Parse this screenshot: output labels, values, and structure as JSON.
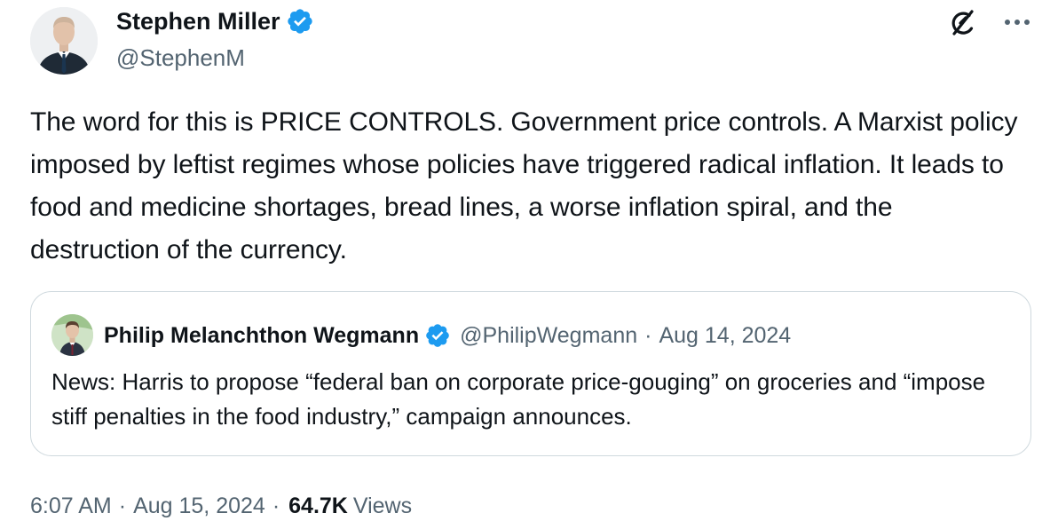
{
  "author": {
    "name": "Stephen Miller",
    "handle": "@StephenM",
    "verified": true
  },
  "tweet": {
    "text": "The word for this is PRICE CONTROLS. Government price controls. A Marxist policy imposed by leftist regimes whose policies have triggered radical inflation. It leads to food and medicine shortages, bread lines, a worse inflation spiral, and the destruction of the currency."
  },
  "quoted_tweet": {
    "author_name": "Philip Melanchthon Wegmann",
    "handle": "@PhilipWegmann",
    "separator": "·",
    "date": "Aug 14, 2024",
    "verified": true,
    "text": "News: Harris to propose “federal ban on corporate price-gouging” on groceries and “impose stiff penalties in the food industry,” campaign announces."
  },
  "meta": {
    "time": "6:07 AM",
    "separator": "·",
    "date": "Aug 15, 2024",
    "views_count": "64.7K",
    "views_label": "Views"
  },
  "icons": {
    "grok": "grok-icon",
    "more": "more-icon",
    "verified": "verified-badge-icon"
  },
  "colors": {
    "verified_blue": "#1d9bf0",
    "secondary_text": "#536471",
    "primary_text": "#0f1419",
    "border": "#cfd9de"
  }
}
